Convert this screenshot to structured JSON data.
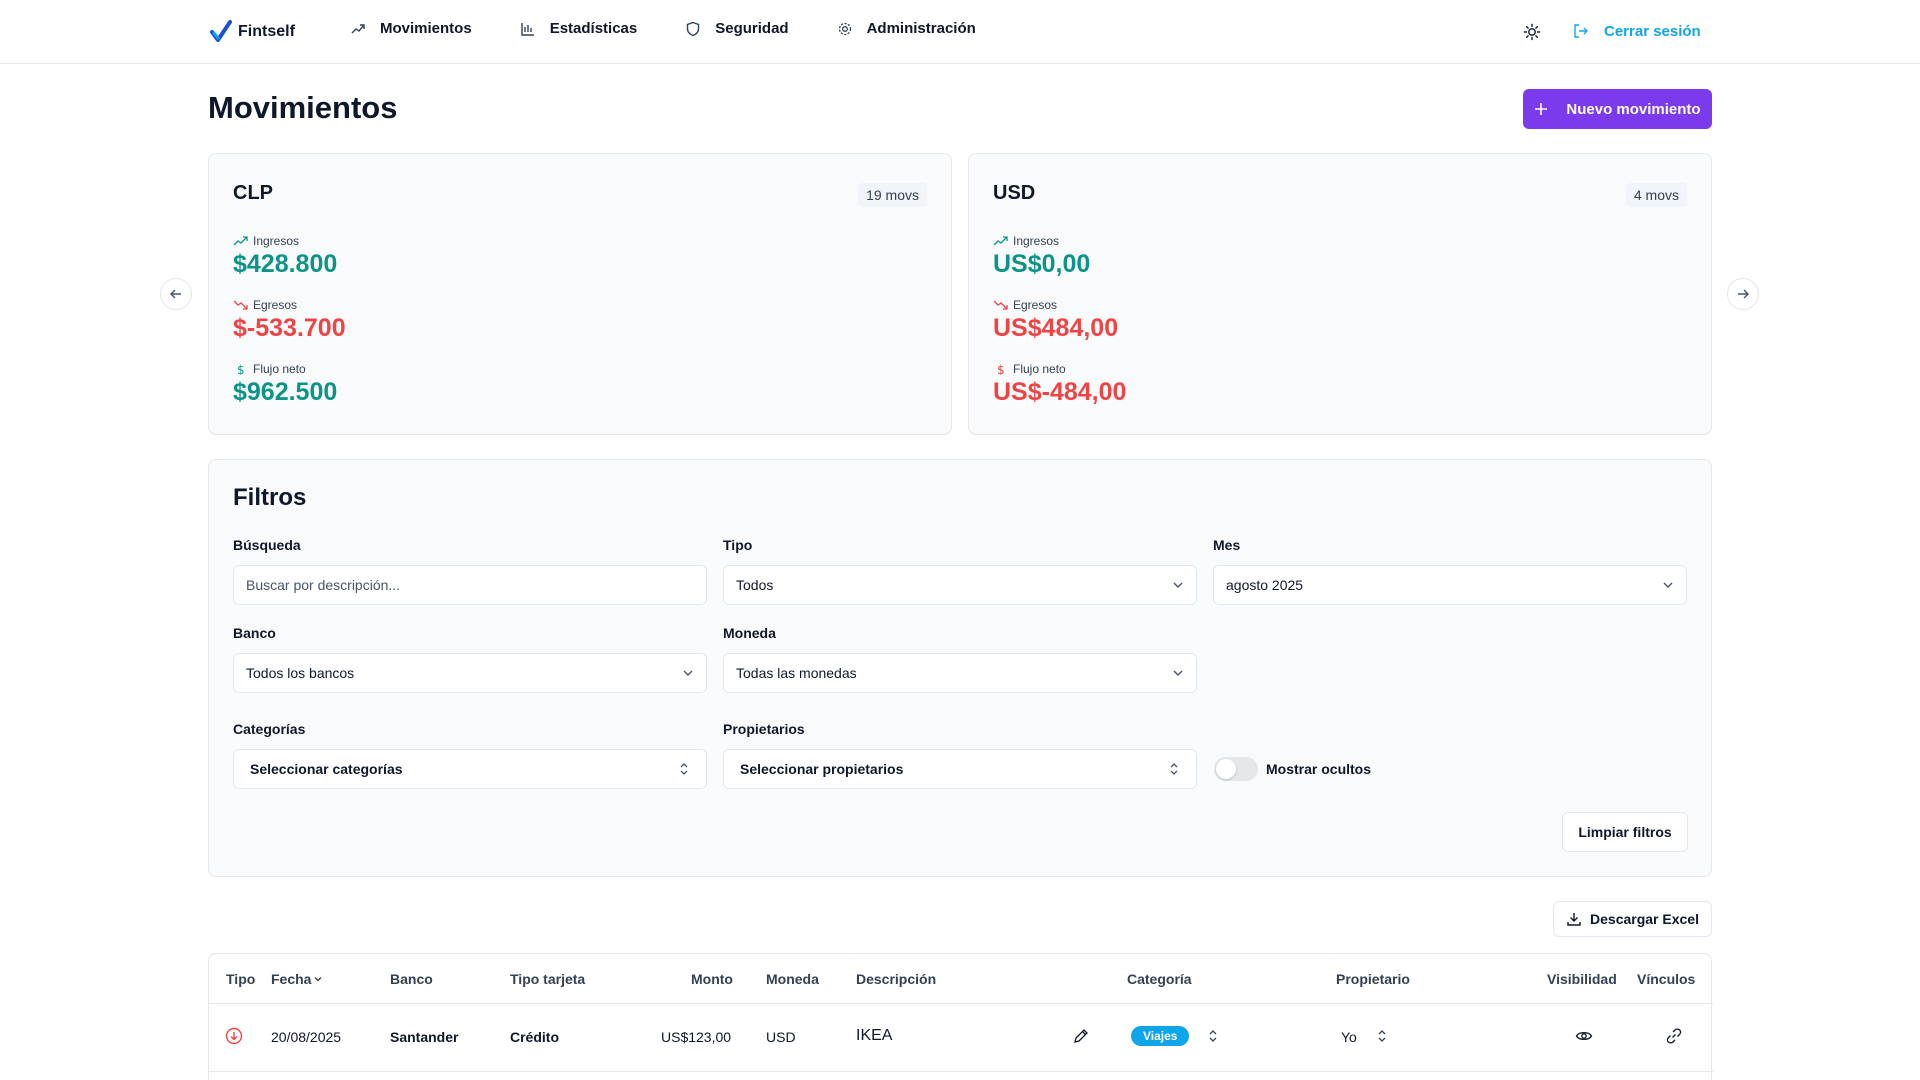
{
  "header": {
    "brand": "Fintself",
    "nav": [
      {
        "label": "Movimientos",
        "icon": "trending-up-icon"
      },
      {
        "label": "Estadísticas",
        "icon": "bar-chart-icon"
      },
      {
        "label": "Seguridad",
        "icon": "shield-icon"
      },
      {
        "label": "Administración",
        "icon": "gear-icon"
      }
    ],
    "logout_label": "Cerrar sesión"
  },
  "page": {
    "title": "Movimientos",
    "new_button": "Nuevo movimiento"
  },
  "cards": [
    {
      "currency": "CLP",
      "count": "19 movs",
      "income_label": "Ingresos",
      "income_value": "$428.800",
      "expense_label": "Egresos",
      "expense_value": "$-533.700",
      "net_label": "Flujo neto",
      "net_value": "$962.500"
    },
    {
      "currency": "USD",
      "count": "4 movs",
      "income_label": "Ingresos",
      "income_value": "US$0,00",
      "expense_label": "Egresos",
      "expense_value": "US$484,00",
      "net_label": "Flujo neto",
      "net_value": "US$-484,00"
    }
  ],
  "filters": {
    "title": "Filtros",
    "search_label": "Búsqueda",
    "search_placeholder": "Buscar por descripción...",
    "type_label": "Tipo",
    "type_value": "Todos",
    "month_label": "Mes",
    "month_value": "agosto 2025",
    "bank_label": "Banco",
    "bank_value": "Todos los bancos",
    "currency_label": "Moneda",
    "currency_value": "Todas las monedas",
    "categories_label": "Categorías",
    "categories_value": "Seleccionar categorías",
    "owners_label": "Propietarios",
    "owners_value": "Seleccionar propietarios",
    "hidden_label": "Mostrar ocultos",
    "clear_button": "Limpiar filtros"
  },
  "download_button": "Descargar Excel",
  "table": {
    "headers": [
      "Tipo",
      "Fecha",
      "Banco",
      "Tipo tarjeta",
      "Monto",
      "Moneda",
      "Descripción",
      "Categoría",
      "Propietario",
      "Visibilidad",
      "Vínculos"
    ],
    "rows": [
      {
        "date": "20/08/2025",
        "bank": "Santander",
        "card_type": "Crédito",
        "amount": "US$123,00",
        "currency": "USD",
        "description": "IKEA",
        "category": "Viajes",
        "owner": "Yo"
      }
    ]
  },
  "colors": {
    "accent": "#7c3aed",
    "link": "#0ea5e9",
    "positive": "#0d9488",
    "negative": "#ef4444"
  }
}
